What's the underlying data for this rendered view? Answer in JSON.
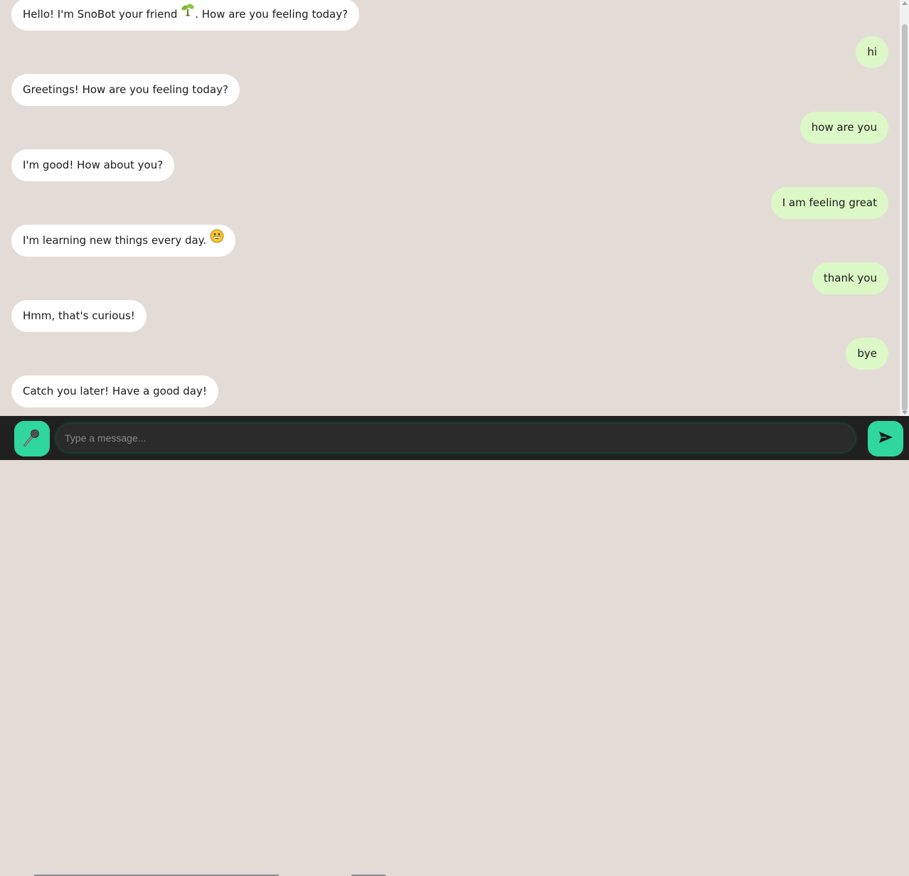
{
  "messages": [
    {
      "sender": "bot",
      "text_before": "Hello! I'm SnoBot your friend ",
      "emoji": "sprout-icon",
      "text_after": ". How are you feeling today?"
    },
    {
      "sender": "user",
      "text": "hi"
    },
    {
      "sender": "bot",
      "text": "Greetings! How are you feeling today?"
    },
    {
      "sender": "user",
      "text": "how are you"
    },
    {
      "sender": "bot",
      "text": "I'm good! How about you?"
    },
    {
      "sender": "user",
      "text": "I am feeling great"
    },
    {
      "sender": "bot",
      "text_before": "I'm learning new things every day. ",
      "emoji": "grinning-face-icon",
      "text_after": ""
    },
    {
      "sender": "user",
      "text": "thank you"
    },
    {
      "sender": "bot",
      "text": "Hmm, that's curious!"
    },
    {
      "sender": "user",
      "text": "bye"
    },
    {
      "sender": "bot",
      "text": "Catch you later! Have a good day!"
    }
  ],
  "input": {
    "placeholder": "Type a message...",
    "value": ""
  },
  "icons": {
    "mic": "microphone-icon",
    "send": "send-icon"
  },
  "colors": {
    "chat_background": "#e3dcd6",
    "bot_bubble": "#ffffff",
    "user_bubble": "#dcf8c6",
    "input_bar": "#202020",
    "accent": "#2fd69d"
  }
}
